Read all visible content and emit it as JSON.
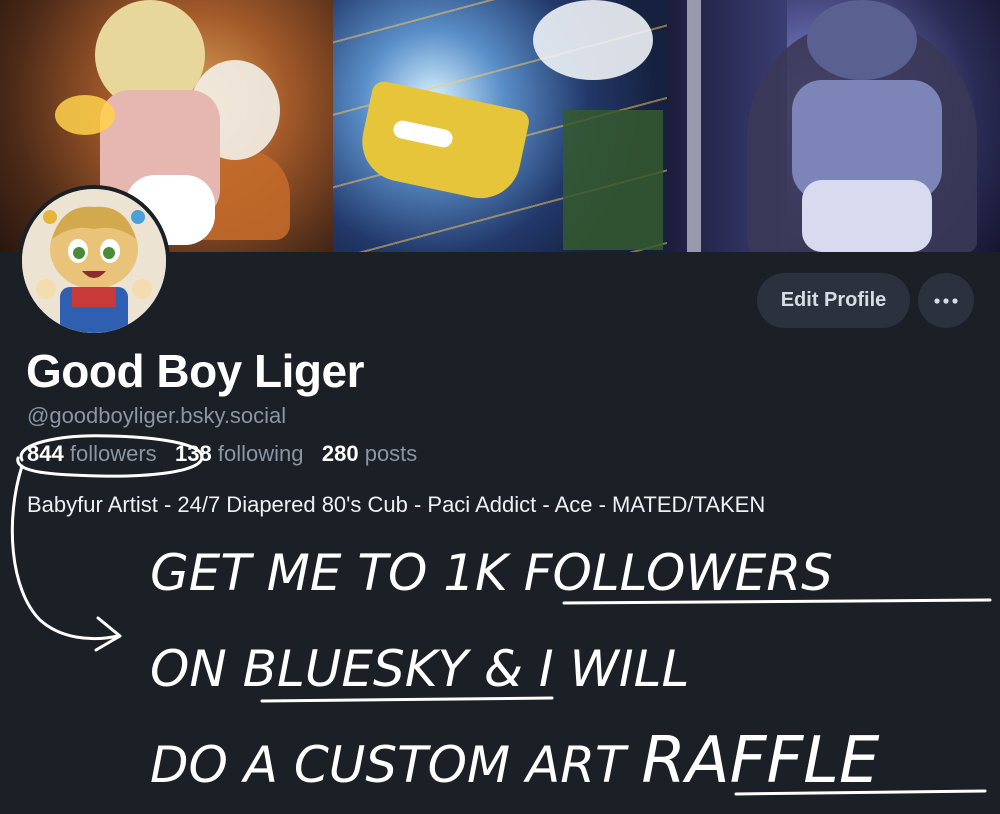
{
  "banner": {
    "images": [
      "artwork-panel-left",
      "artwork-panel-middle",
      "artwork-panel-right"
    ]
  },
  "profile": {
    "display_name": "Good Boy Liger",
    "handle": "@goodboyliger.bsky.social",
    "followers_count": "844",
    "followers_label": "followers",
    "following_count": "138",
    "following_label": "following",
    "posts_count": "280",
    "posts_label": "posts",
    "bio": "Babyfur Artist - 24/7 Diapered 80's Cub - Paci Addict  - Ace - MATED/TAKEN"
  },
  "actions": {
    "edit_profile_label": "Edit Profile",
    "more_icon": "ellipsis-icon"
  },
  "handwritten_note": {
    "line1_prefix": "GET ME TO ",
    "line1_emphasis": "1K FOLLOWERS",
    "line2_prefix": "ON ",
    "line2_emphasis": "BLUESKY",
    "line2_suffix": " & I WILL",
    "line3_prefix": "DO A CUSTOM ART ",
    "line3_emphasis": "RAFFLE",
    "ink_color": "#ffffff"
  }
}
